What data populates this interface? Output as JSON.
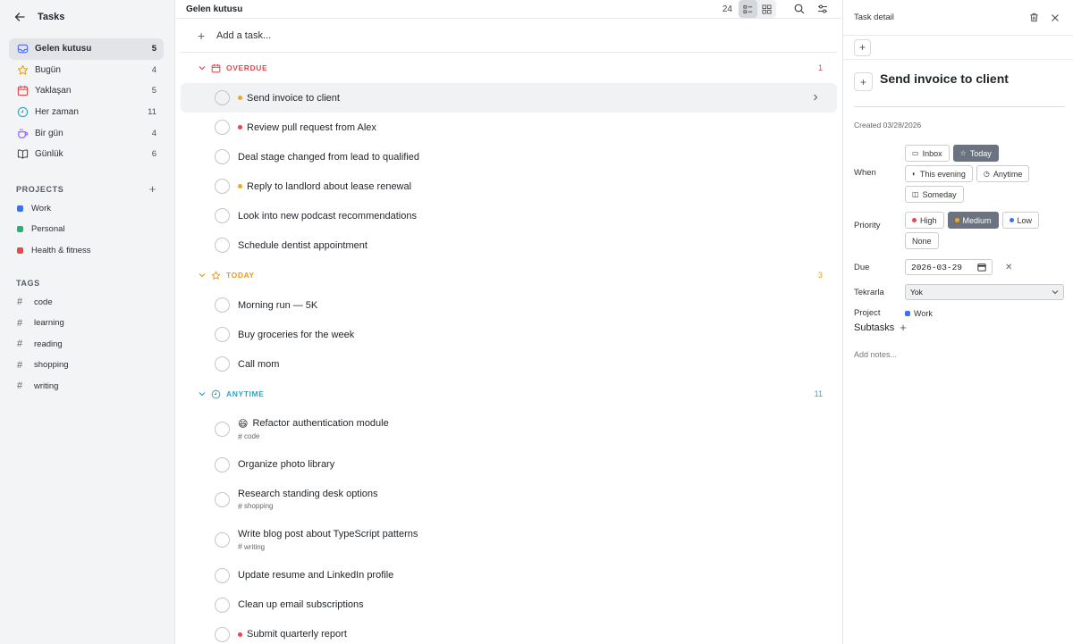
{
  "sidebar": {
    "title": "Tasks",
    "nav": [
      {
        "label": "Gelen kutusu",
        "count": "5",
        "icon": "inbox-icon",
        "color": "#4a6cf7"
      },
      {
        "label": "Bugün",
        "count": "4",
        "icon": "star-icon",
        "color": "#e89a1a"
      },
      {
        "label": "Yaklaşan",
        "count": "5",
        "icon": "calendar-icon",
        "color": "#e5484d"
      },
      {
        "label": "Her zaman",
        "count": "11",
        "icon": "clock-icon",
        "color": "#2fa5c8"
      },
      {
        "label": "Bir gün",
        "count": "4",
        "icon": "cup-icon",
        "color": "#8b5cf6"
      },
      {
        "label": "Günlük",
        "count": "6",
        "icon": "book-icon",
        "color": "#444"
      }
    ],
    "projects_label": "PROJECTS",
    "projects": [
      {
        "label": "Work",
        "color": "#3b6ff5"
      },
      {
        "label": "Personal",
        "color": "#22b573"
      },
      {
        "label": "Health & fitness",
        "color": "#e5484d"
      }
    ],
    "tags_label": "TAGS",
    "tags": [
      "code",
      "learning",
      "reading",
      "shopping",
      "writing"
    ]
  },
  "main": {
    "title": "Gelen kutusu",
    "count": "24",
    "add_placeholder": "Add a task...",
    "groups": {
      "overdue": {
        "label": "OVERDUE",
        "count": "1"
      },
      "today": {
        "label": "TODAY",
        "count": "3"
      },
      "anytime": {
        "label": "ANYTIME",
        "count": "11"
      }
    },
    "overdue_tasks": [
      {
        "title": "Send invoice to client",
        "priority": "medium"
      },
      {
        "title": "Review pull request from Alex",
        "priority": "high"
      },
      {
        "title": "Deal stage changed from lead to qualified",
        "priority": ""
      },
      {
        "title": "Reply to landlord about lease renewal",
        "priority": "medium"
      },
      {
        "title": "Look into new podcast recommendations",
        "priority": ""
      },
      {
        "title": "Schedule dentist appointment",
        "priority": ""
      }
    ],
    "today_tasks": [
      {
        "title": "Morning run — 5K"
      },
      {
        "title": "Buy groceries for the week"
      },
      {
        "title": "Call mom"
      }
    ],
    "anytime_tasks": [
      {
        "title": "Refactor authentication module",
        "emoji": "😄",
        "tag": "code"
      },
      {
        "title": "Organize photo library"
      },
      {
        "title": "Research standing desk options",
        "tag": "shopping"
      },
      {
        "title": "Write blog post about TypeScript patterns",
        "tag": "writing"
      },
      {
        "title": "Update resume and LinkedIn profile"
      },
      {
        "title": "Clean up email subscriptions"
      },
      {
        "title": "Submit quarterly report",
        "priority": "high"
      }
    ]
  },
  "detail": {
    "title": "Task detail",
    "task_title": "Send invoice to client",
    "created": "Created 03/28/2026",
    "when_label": "When",
    "when_options": [
      {
        "label": "Inbox",
        "active": false,
        "icon": "inbox-icon"
      },
      {
        "label": "Today",
        "active": true,
        "icon": "star-icon"
      },
      {
        "label": "This evening",
        "active": false,
        "icon": "moon-icon"
      },
      {
        "label": "Anytime",
        "active": false,
        "icon": "clock-icon"
      },
      {
        "label": "Someday",
        "active": false,
        "icon": "cup-icon"
      }
    ],
    "priority_label": "Priority",
    "priority_options": [
      {
        "label": "High",
        "active": false,
        "color": "#e5484d"
      },
      {
        "label": "Medium",
        "active": true,
        "color": "#f5a524"
      },
      {
        "label": "Low",
        "active": false,
        "color": "#3b6ff5"
      },
      {
        "label": "None",
        "active": false,
        "color": ""
      }
    ],
    "due_label": "Due",
    "due_value": "2026-03-29",
    "repeat_label": "Tekrarla",
    "repeat_value": "Yok",
    "project_label": "Project",
    "project_value": "Work",
    "subtasks_label": "Subtasks",
    "notes_placeholder": "Add notes..."
  },
  "colors": {
    "high": "#e5484d",
    "medium": "#f5a524",
    "low": "#3b6ff5"
  }
}
